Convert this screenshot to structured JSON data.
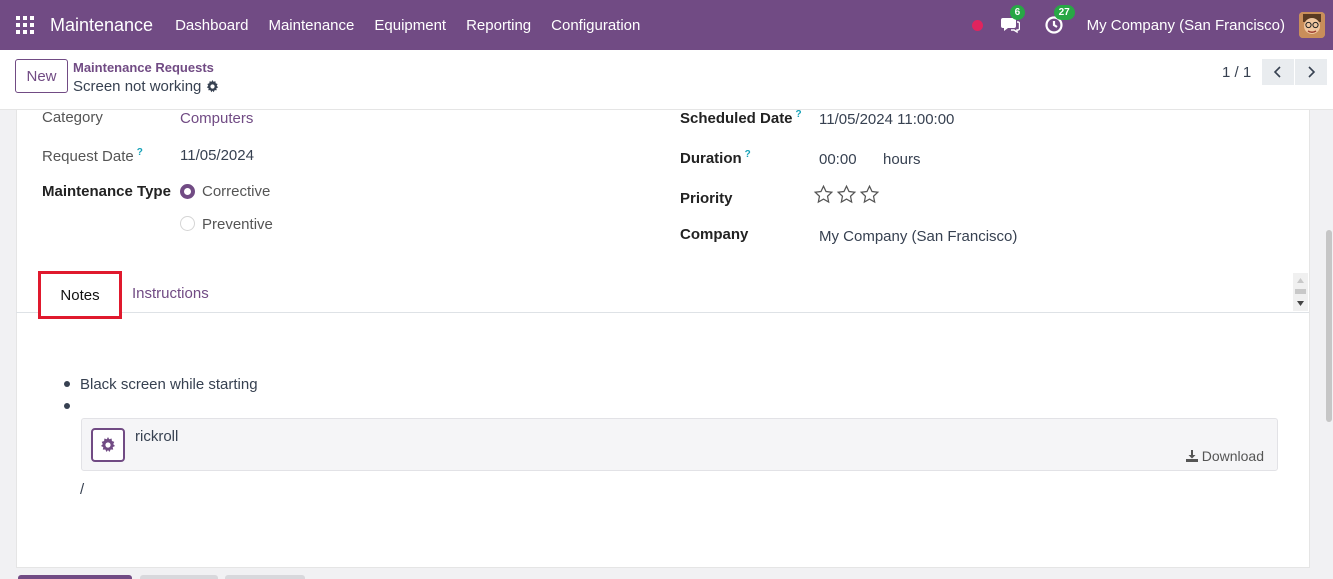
{
  "navbar": {
    "brand": "Maintenance",
    "menu": [
      "Dashboard",
      "Maintenance",
      "Equipment",
      "Reporting",
      "Configuration"
    ],
    "messages_count": "6",
    "activities_count": "27",
    "company": "My Company (San Francisco)"
  },
  "control": {
    "new_label": "New",
    "breadcrumb": "Maintenance Requests",
    "record_title": "Screen not working",
    "pager": "1 / 1"
  },
  "form": {
    "category_label": "Category",
    "category_value": "Computers",
    "request_date_label": "Request Date",
    "request_date_value": "11/05/2024",
    "maintenance_type_label": "Maintenance Type",
    "type_options": [
      "Corrective",
      "Preventive"
    ],
    "selected_type": "Corrective",
    "scheduled_date_label": "Scheduled Date",
    "scheduled_date_value": "11/05/2024 11:00:00",
    "duration_label": "Duration",
    "duration_value": "00:00",
    "duration_unit": "hours",
    "priority_label": "Priority",
    "priority_stars": 0,
    "priority_max": 3,
    "company_label": "Company",
    "company_value": "My Company (San Francisco)",
    "help_mark": "?"
  },
  "tabs": [
    {
      "label": "Notes",
      "active": true
    },
    {
      "label": "Instructions",
      "active": false
    }
  ],
  "notes": {
    "bullets": [
      "Black screen while starting",
      ""
    ],
    "attachment_name": "rickroll",
    "download_label": "Download",
    "trailing_text": "/"
  },
  "colors": {
    "brand": "#714b84",
    "highlight": "#e0192d",
    "badge": "#28a745",
    "help": "#17a2b8"
  }
}
